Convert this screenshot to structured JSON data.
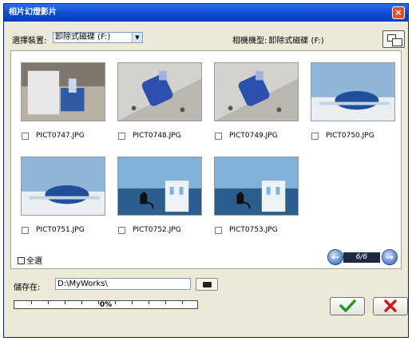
{
  "window": {
    "title": "相片幻燈影片",
    "close_label": "×"
  },
  "toolbar": {
    "device_label": "選擇裝置:",
    "device_value": "卸除式磁碟 (F:)",
    "camera_model_label": "相機機型:",
    "camera_model_value": "卸除式磁碟 (F:)"
  },
  "photos": [
    {
      "name": "PICT0747.JPG",
      "checked": false,
      "scene": "desk"
    },
    {
      "name": "PICT0748.JPG",
      "checked": false,
      "scene": "bottle"
    },
    {
      "name": "PICT0749.JPG",
      "checked": false,
      "scene": "bottle"
    },
    {
      "name": "PICT0750.JPG",
      "checked": false,
      "scene": "dome"
    },
    {
      "name": "PICT0751.JPG",
      "checked": false,
      "scene": "dome"
    },
    {
      "name": "PICT0752.JPG",
      "checked": false,
      "scene": "cat"
    },
    {
      "name": "PICT0753.JPG",
      "checked": false,
      "scene": "cat"
    }
  ],
  "select_all": {
    "label": "全選",
    "checked": false
  },
  "pager": {
    "current": 6,
    "total": 6,
    "text": "6/6"
  },
  "save": {
    "label": "儲存在:",
    "path": "D:\\MyWorks\\"
  },
  "progress": {
    "percent": 0,
    "text": "0%"
  },
  "colors": {
    "titlebar": "#0b47d0",
    "ok": "#1f9a2a",
    "cancel": "#d21a1a",
    "panel": "#ece9d8"
  }
}
